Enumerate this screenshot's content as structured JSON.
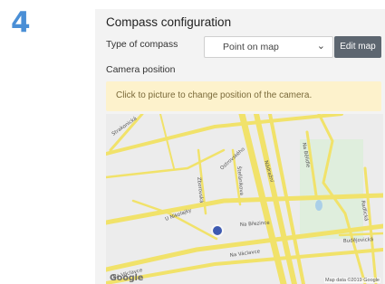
{
  "step": {
    "number": "4"
  },
  "panel": {
    "title": "Compass configuration",
    "type_label": "Type of compass",
    "type_select": {
      "value": "Point on map"
    },
    "edit_button": "Edit map",
    "camera_label": "Camera position",
    "hint": "Click to picture to change position of the camera."
  },
  "map": {
    "streets": {
      "s1": "Strakonická",
      "s2": "Ostrovského",
      "s3": "Nádražní",
      "s4": "Na Bělidle",
      "s5": "Štefánikova",
      "s6": "Zborovská",
      "s7": "U Nikolajky",
      "s8": "Na Březince",
      "s9": "Na Václavce",
      "s10": "Na Václavce",
      "s11": "Radlická",
      "s12": "Budějovická"
    },
    "logo": "Google",
    "attribution": "Map data ©2019 Google",
    "marker_color": "#3d5ab1",
    "road_color": "#f1e26a"
  }
}
